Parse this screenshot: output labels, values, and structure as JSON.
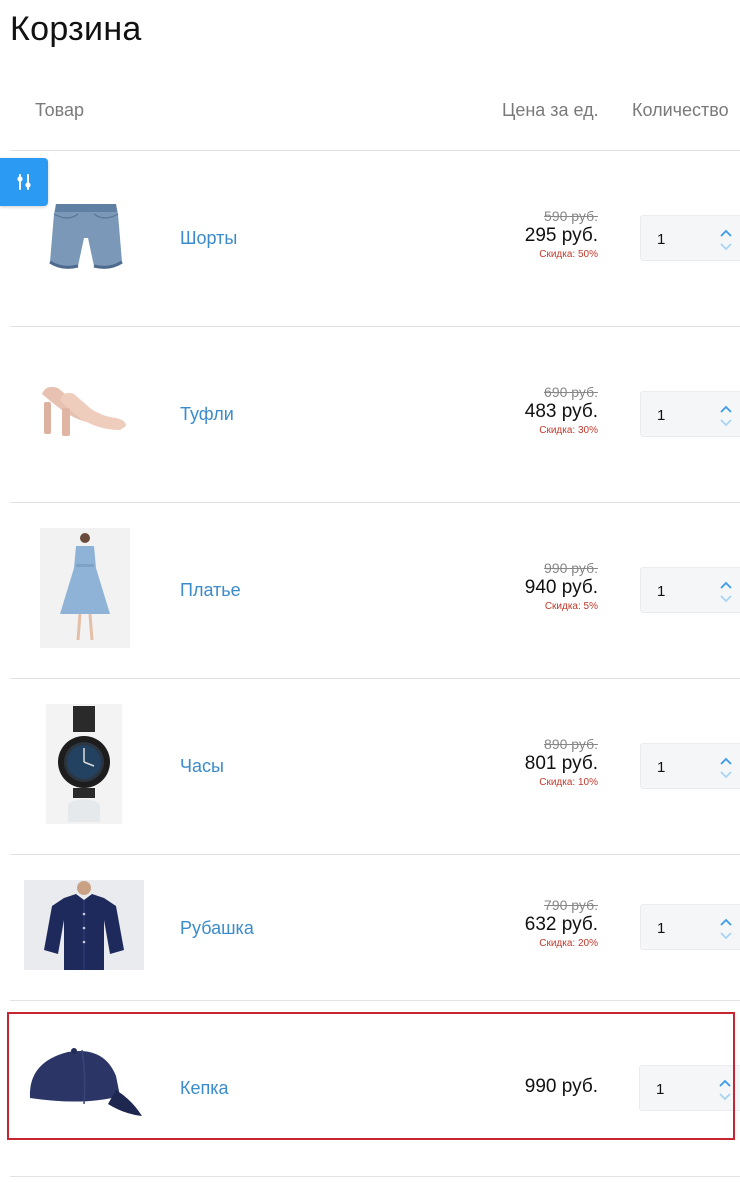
{
  "page": {
    "title": "Корзина"
  },
  "columns": {
    "item": "Товар",
    "price": "Цена за ед.",
    "quantity": "Количество"
  },
  "colors": {
    "accent": "#2b9af3",
    "link": "#3a8bcc",
    "discount": "#c0392b",
    "highlight": "#c62630"
  },
  "filter_button": {
    "icon": "sliders-icon"
  },
  "items": [
    {
      "name": "Шорты",
      "old_price": "590 руб.",
      "price": "295 руб.",
      "discount": "Скидка: 50%",
      "quantity": "1",
      "image": "shorts-image"
    },
    {
      "name": "Туфли",
      "old_price": "690 руб.",
      "price": "483 руб.",
      "discount": "Скидка: 30%",
      "quantity": "1",
      "image": "shoes-image"
    },
    {
      "name": "Платье",
      "old_price": "990 руб.",
      "price": "940 руб.",
      "discount": "Скидка: 5%",
      "quantity": "1",
      "image": "dress-image"
    },
    {
      "name": "Часы",
      "old_price": "890 руб.",
      "price": "801 руб.",
      "discount": "Скидка: 10%",
      "quantity": "1",
      "image": "watch-image"
    },
    {
      "name": "Рубашка",
      "old_price": "790 руб.",
      "price": "632 руб.",
      "discount": "Скидка: 20%",
      "quantity": "1",
      "image": "shirt-image"
    },
    {
      "name": "Кепка",
      "price": "990 руб.",
      "quantity": "1",
      "image": "cap-image"
    }
  ]
}
